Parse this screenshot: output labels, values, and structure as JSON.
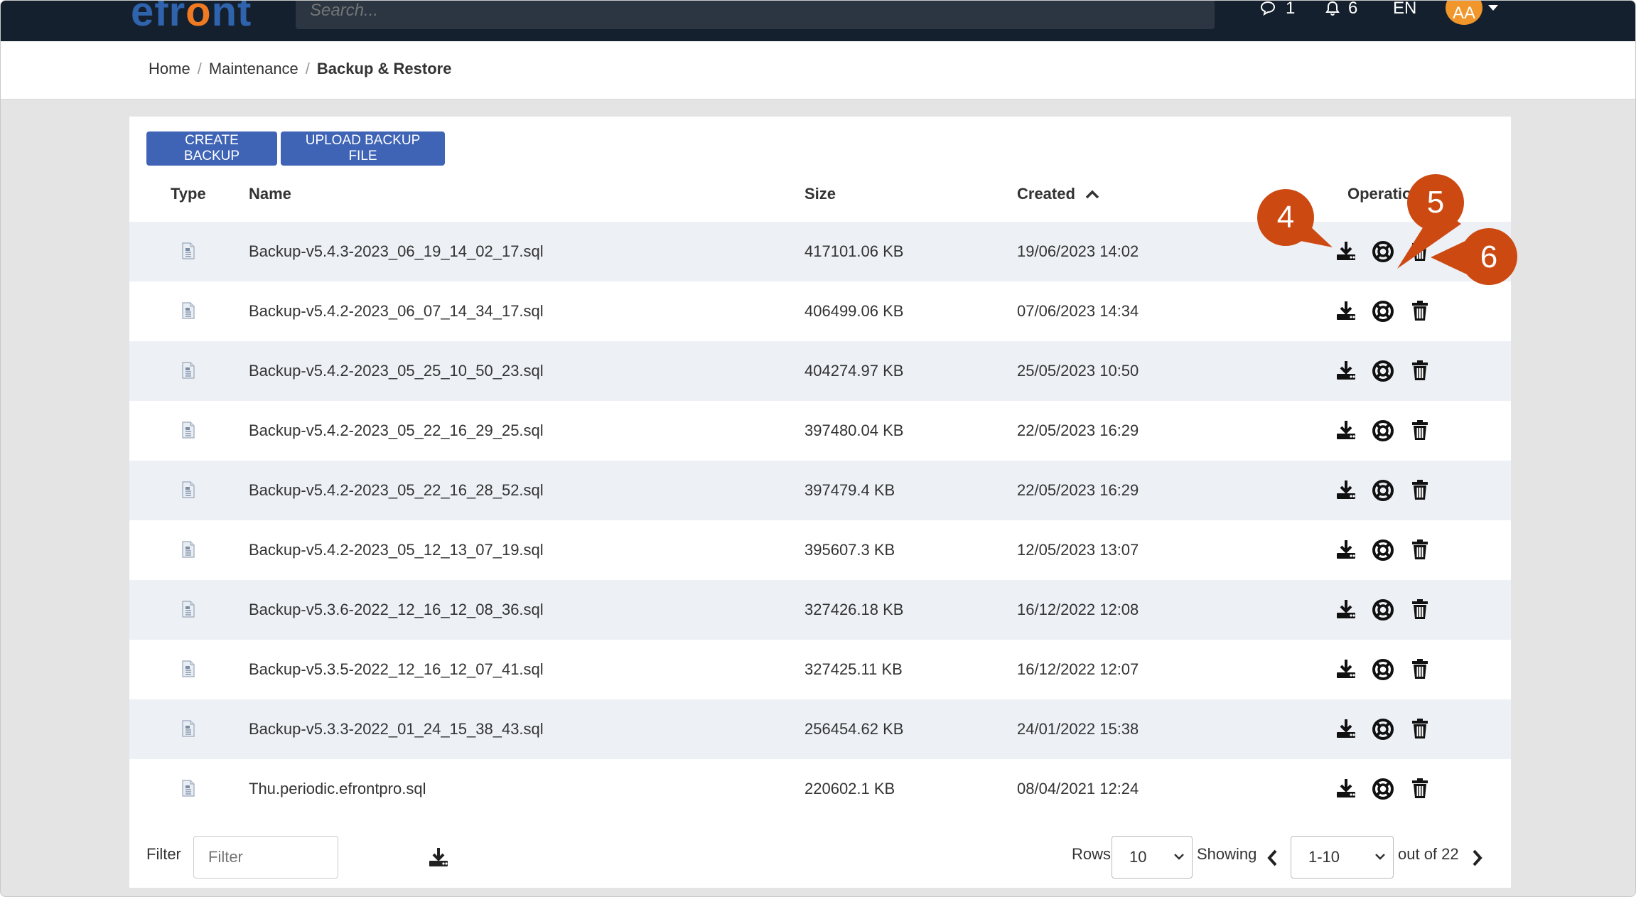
{
  "header": {
    "logo_left": "efr",
    "logo_o": "o",
    "logo_right": "nt",
    "search_placeholder": "Search...",
    "messages_count": "1",
    "notifications_count": "6",
    "language": "EN",
    "avatar_initials": "AA"
  },
  "breadcrumb": {
    "items": [
      "Home",
      "Maintenance"
    ],
    "separator": "/",
    "current": "Backup & Restore"
  },
  "toolbar": {
    "create_label": "CREATE BACKUP",
    "upload_label": "UPLOAD BACKUP FILE"
  },
  "table": {
    "columns": [
      "Type",
      "Name",
      "Size",
      "Created",
      "Operations"
    ],
    "sort_column": "Created",
    "sort_direction": "ascending",
    "rows": [
      {
        "name": "Backup-v5.4.3-2023_06_19_14_02_17.sql",
        "size": "417101.06 KB",
        "created": "19/06/2023 14:02"
      },
      {
        "name": "Backup-v5.4.2-2023_06_07_14_34_17.sql",
        "size": "406499.06 KB",
        "created": "07/06/2023 14:34"
      },
      {
        "name": "Backup-v5.4.2-2023_05_25_10_50_23.sql",
        "size": "404274.97 KB",
        "created": "25/05/2023 10:50"
      },
      {
        "name": "Backup-v5.4.2-2023_05_22_16_29_25.sql",
        "size": "397480.04 KB",
        "created": "22/05/2023 16:29"
      },
      {
        "name": "Backup-v5.4.2-2023_05_22_16_28_52.sql",
        "size": "397479.4 KB",
        "created": "22/05/2023 16:29"
      },
      {
        "name": "Backup-v5.4.2-2023_05_12_13_07_19.sql",
        "size": "395607.3 KB",
        "created": "12/05/2023 13:07"
      },
      {
        "name": "Backup-v5.3.6-2022_12_16_12_08_36.sql",
        "size": "327426.18 KB",
        "created": "16/12/2022 12:08"
      },
      {
        "name": "Backup-v5.3.5-2022_12_16_12_07_41.sql",
        "size": "327425.11 KB",
        "created": "16/12/2022 12:07"
      },
      {
        "name": "Backup-v5.3.3-2022_01_24_15_38_43.sql",
        "size": "256454.62 KB",
        "created": "24/01/2022 15:38"
      },
      {
        "name": "Thu.periodic.efrontpro.sql",
        "size": "220602.1 KB",
        "created": "08/04/2021 12:24"
      }
    ]
  },
  "footer": {
    "filter_label": "Filter",
    "filter_placeholder": "Filter",
    "rows_label": "Rows",
    "rows_value": "10",
    "showing_label": "Showing",
    "page_range": "1-10",
    "total_text": "out of 22"
  },
  "callouts": [
    "4",
    "5",
    "6"
  ],
  "colors": {
    "accent": "#3f64b5",
    "topbar": "#14202d",
    "callout": "#cc4a12",
    "avatar": "#f0962a"
  }
}
